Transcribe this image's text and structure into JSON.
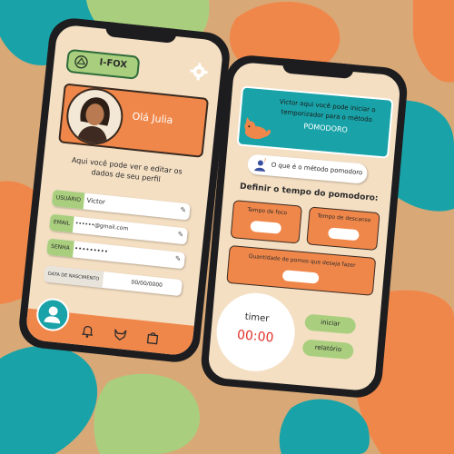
{
  "colors": {
    "bg": "#d9a877",
    "orange": "#f0874a",
    "teal": "#19a3a8",
    "green": "#a9cf7e",
    "cream": "#f4dfc3",
    "dark": "#1d1d1f"
  },
  "profile_screen": {
    "app_name": "I-FOX",
    "greeting": "Olá Julia",
    "instruction": "Aqui você pode ver e editar os dados de seu perfil",
    "fields": [
      {
        "label": "USUÁRIO",
        "value": "Victor"
      },
      {
        "label": "EMAIL",
        "value": "••••••@gmail.com"
      },
      {
        "label": "SENHA",
        "value": "•••••••••"
      },
      {
        "label": "DATA DE NASCIMENTO",
        "value": "00/00/0000"
      }
    ],
    "icons": {
      "settings": "gear-icon",
      "logo": "fox-logo-icon",
      "edit": "pencil-icon",
      "nav": [
        "user-icon",
        "bell-icon",
        "fox-icon",
        "bag-icon"
      ]
    }
  },
  "pomodoro_screen": {
    "banner_line1": "Victor aqui você pode iniciar o",
    "banner_line2": "temporizador para o método",
    "banner_highlight": "POMODORO",
    "info_button": "O que é o método pomodoro",
    "section_title": "Definir o tempo do pomodoro:",
    "focus_label": "Tempo de foco",
    "rest_label": "Tempo de descanso",
    "rounds_label": "Quantidade de pomos que deseja fazer",
    "timer_label": "timer",
    "timer_value": "00:00",
    "start_button": "iniciar",
    "report_button": "relatório"
  }
}
